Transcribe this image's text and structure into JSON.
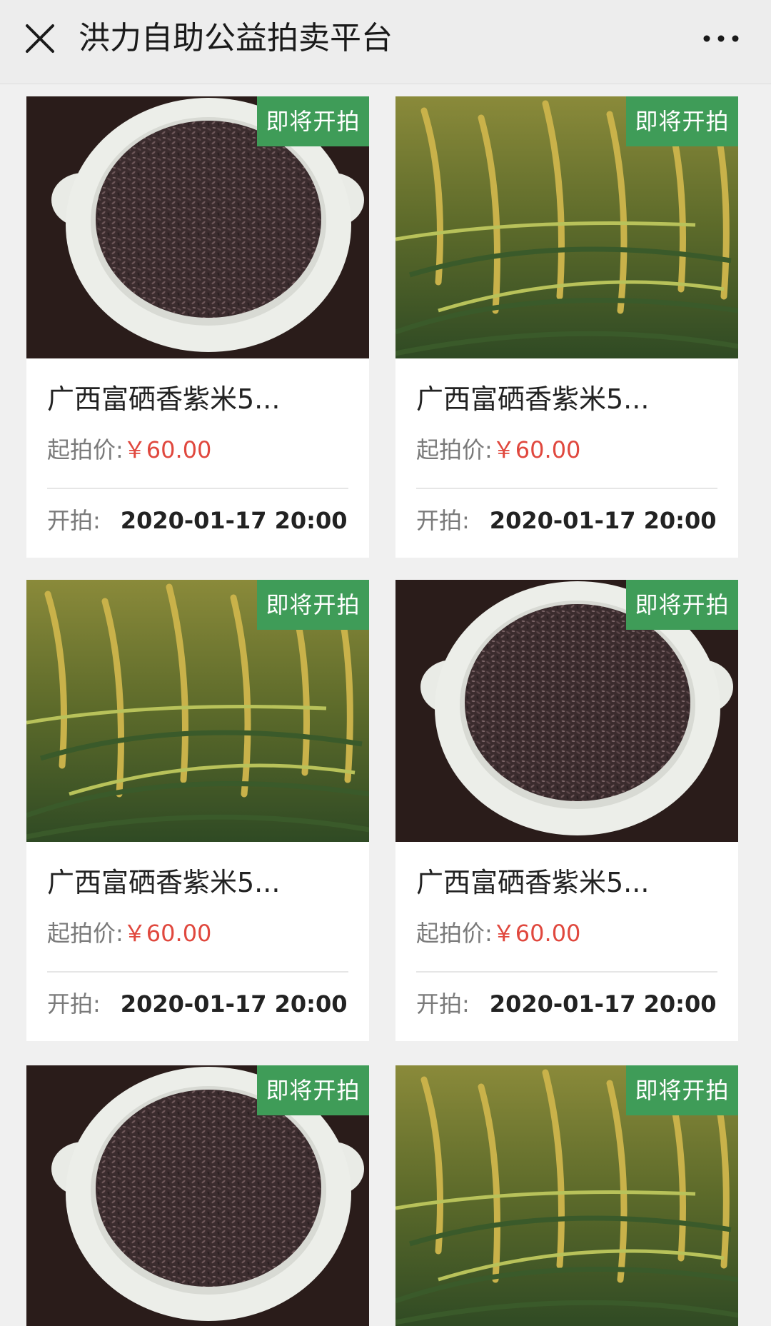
{
  "header": {
    "title": "洪力自助公益拍卖平台",
    "close_icon": "close-icon",
    "more_icon": "more-dots-icon"
  },
  "colors": {
    "badge_green": "#3f9c58",
    "price_red": "#e0483e",
    "background": "#f0f0f0"
  },
  "items": [
    {
      "image": "purple-rice-bowl-photo",
      "badge": "即将开拍",
      "name": "广西富硒香紫米5...",
      "price_label": "起拍价:",
      "price": "￥60.00",
      "start_label": "开拍:",
      "start_time": "2020-01-17 20:00"
    },
    {
      "image": "rice-field-photo",
      "badge": "即将开拍",
      "name": "广西富硒香紫米5...",
      "price_label": "起拍价:",
      "price": "￥60.00",
      "start_label": "开拍:",
      "start_time": "2020-01-17 20:00"
    },
    {
      "image": "rice-field-photo",
      "badge": "即将开拍",
      "name": "广西富硒香紫米5...",
      "price_label": "起拍价:",
      "price": "￥60.00",
      "start_label": "开拍:",
      "start_time": "2020-01-17 20:00"
    },
    {
      "image": "purple-rice-bowl-photo",
      "badge": "即将开拍",
      "name": "广西富硒香紫米5...",
      "price_label": "起拍价:",
      "price": "￥60.00",
      "start_label": "开拍:",
      "start_time": "2020-01-17 20:00"
    },
    {
      "image": "purple-rice-bowl-photo",
      "badge": "即将开拍"
    },
    {
      "image": "rice-field-photo",
      "badge": "即将开拍"
    }
  ]
}
